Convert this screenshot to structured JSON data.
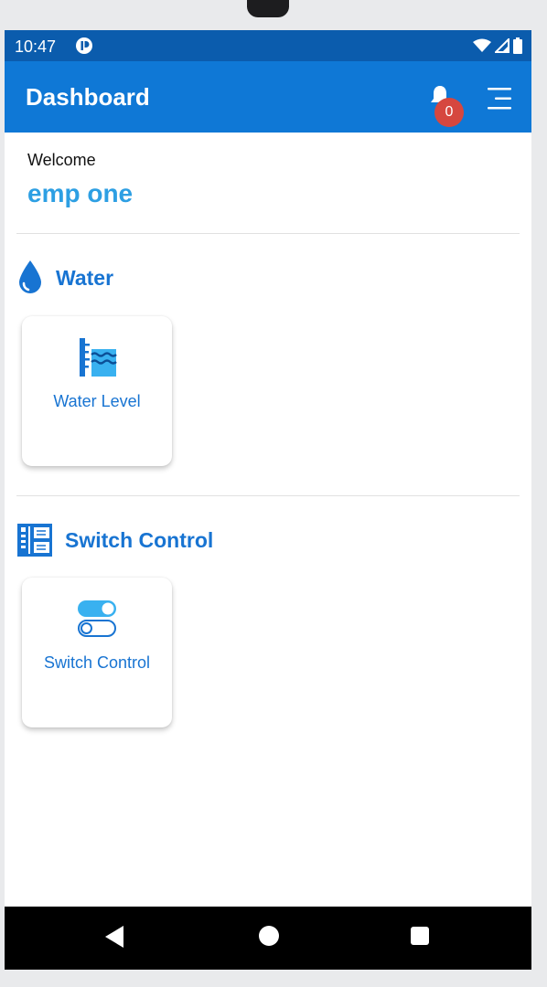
{
  "status_bar": {
    "time": "10:47"
  },
  "app_bar": {
    "title": "Dashboard",
    "notification_count": "0"
  },
  "user": {
    "greeting": "Welcome",
    "name": "emp one"
  },
  "sections": [
    {
      "title": "Water",
      "icon": "water-drop-icon",
      "cards": [
        {
          "label": "Water Level",
          "icon": "water-level-icon"
        }
      ]
    },
    {
      "title": "Switch Control",
      "icon": "control-panel-icon",
      "cards": [
        {
          "label": "Switch Control",
          "icon": "toggle-switch-icon"
        }
      ]
    }
  ],
  "colors": {
    "status_bar": "#0b5cad",
    "app_bar": "#0f78d6",
    "accent": "#1874d2",
    "user_name": "#2d9fe3",
    "badge": "#d6473f"
  }
}
